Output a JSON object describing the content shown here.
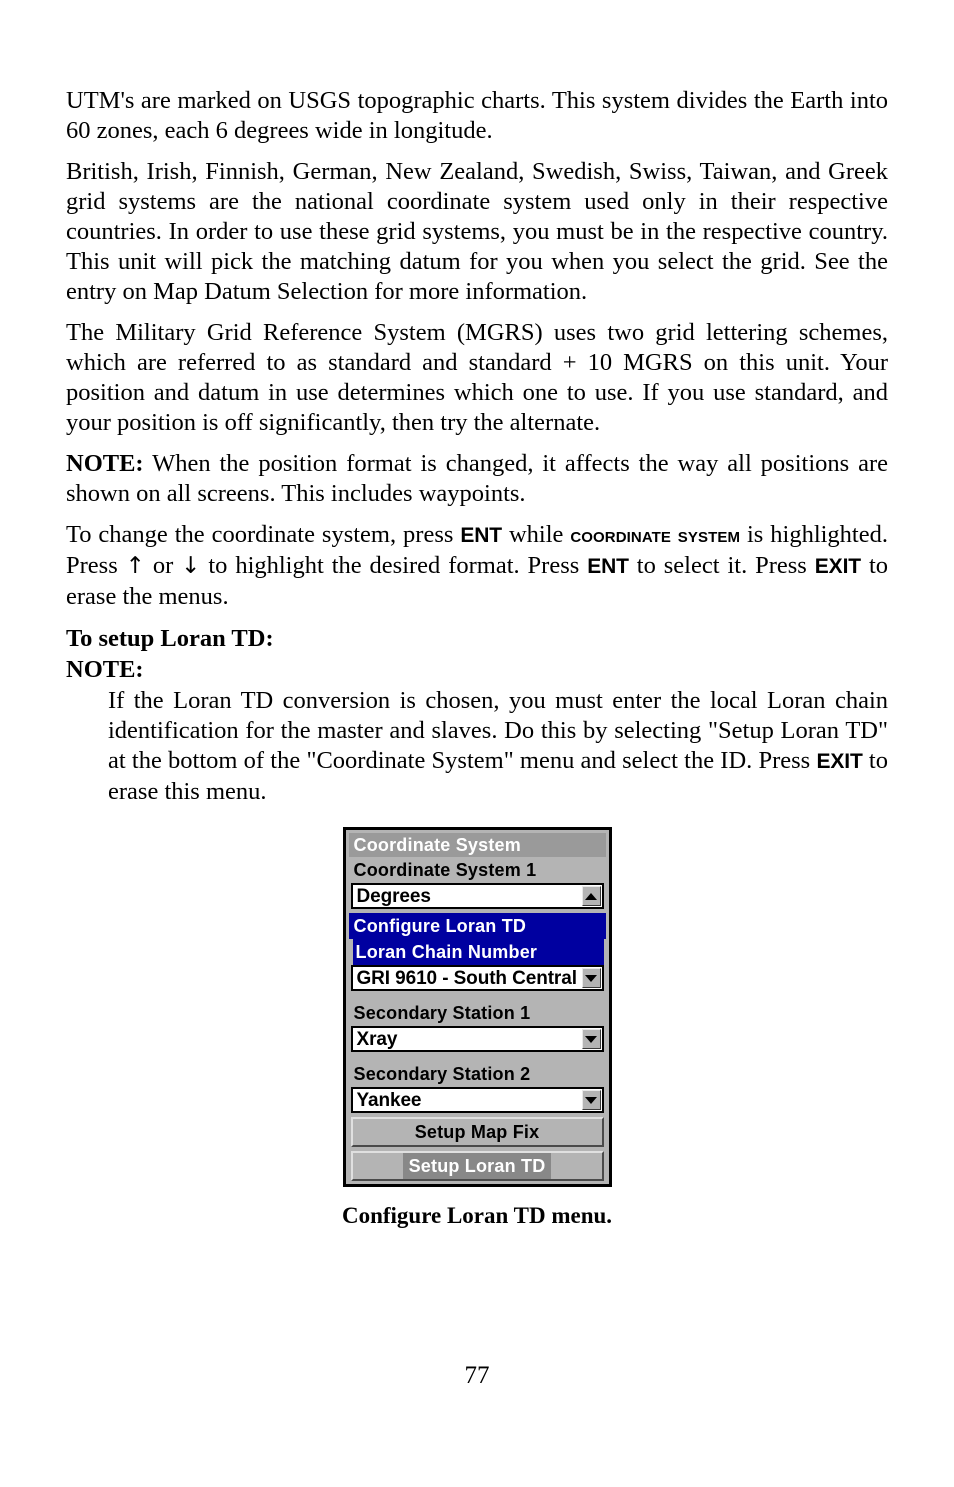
{
  "page": {
    "number": "77"
  },
  "paragraphs": {
    "p1": "UTM's are marked on USGS topographic charts. This system divides the Earth into 60 zones, each 6 degrees wide in longitude.",
    "p2": "British, Irish, Finnish, German, New Zealand, Swedish, Swiss, Taiwan, and Greek grid systems are the national coordinate system used only in their respective countries. In order to use these grid systems, you must be in the respective country. This unit will pick the matching datum for you when you select the grid. See the entry on Map Datum Selection for more information.",
    "p3": "The Military Grid Reference System (MGRS) uses two grid lettering schemes, which are referred to as standard and standard + 10 MGRS on this unit. Your position and datum in use determines which one to use. If you use standard, and your position is off significantly, then try the alternate.",
    "note1_lead": "NOTE:",
    "note1_text": " When the position format is changed, it affects the way all positions are shown on all screens. This includes waypoints.",
    "p5_a": "To change the coordinate system, press ",
    "p5_key1": "ENT",
    "p5_b": " while ",
    "p5_smallcaps": "Coordinate System",
    "p5_c": " is highlighted. Press ",
    "p5_arrow_up": "↑",
    "p5_d": " or ",
    "p5_arrow_down": "↓",
    "p5_e": " to highlight the desired format. Press ",
    "p5_key2": "ENT",
    "p5_f": " to select it. Press ",
    "p5_key3": "EXIT",
    "p5_g": " to erase the menus.",
    "heading_setup": "To setup Loran TD:",
    "heading_note": "NOTE:",
    "note2_a": "If the Loran TD conversion is chosen, you must enter the local Loran chain identification for the master and slaves. Do this by selecting \"Setup Loran TD\" at the bottom of the \"Coordinate System\" menu and select the ID. Press ",
    "note2_key": "EXIT",
    "note2_b": " to erase this menu."
  },
  "figure": {
    "caption": "Configure Loran TD menu.",
    "colors": {
      "panel_gray": "#b4b4b4",
      "titlebar_gray": "#9a9a9a",
      "highlight_blue": "#0000a0",
      "selected_gray": "#888888",
      "field_white": "#ffffff",
      "border_black": "#000000"
    },
    "screen": {
      "title": "Coordinate System",
      "rows": [
        {
          "label": "Coordinate System 1",
          "value": "Degrees",
          "spinner": "up-arrow"
        },
        {
          "label": "Configure Loran TD",
          "highlight": "blue-full"
        },
        {
          "label": "Loran Chain Number",
          "value": "GRI 9610 - South Central",
          "highlight": "blue-inset",
          "spinner": "down-arrow"
        },
        {
          "label": "Secondary Station 1",
          "value": "Xray",
          "spinner": "down-arrow"
        },
        {
          "label": "Secondary Station 2",
          "value": "Yankee",
          "spinner": "down-arrow"
        }
      ],
      "buttons": [
        {
          "label": "Setup Map Fix",
          "selected": false
        },
        {
          "label": "Setup Loran TD",
          "selected": true
        }
      ]
    }
  }
}
